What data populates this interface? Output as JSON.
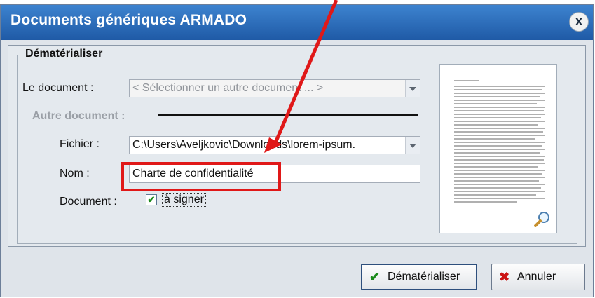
{
  "window": {
    "title": "Documents génériques ARMADO",
    "close_symbol": "x"
  },
  "group": {
    "legend": "Dématérialiser"
  },
  "fields": {
    "document_label": "Le document :",
    "document_value": "< Sélectionner un autre document ... >",
    "other_document_label": "Autre document :",
    "file_label": "Fichier :",
    "file_value": "C:\\Users\\Aveljkovic\\Downloads\\lorem-ipsum.",
    "name_label": "Nom :",
    "name_value": "Charte de confidentialité",
    "document_type_label": "Document :",
    "sign_checkbox_label": "à signer",
    "sign_checked": true
  },
  "buttons": {
    "dematerialize": "Dématérialiser",
    "cancel": "Annuler"
  },
  "colors": {
    "title_bar": "#2a6ab8",
    "annotation": "#e01818",
    "check": "#1b8a1b",
    "cancel_icon": "#cc1414"
  },
  "icons": [
    "close-icon",
    "dropdown-arrow-icon",
    "checkmark-icon",
    "magnifier-icon",
    "cancel-x-icon"
  ]
}
